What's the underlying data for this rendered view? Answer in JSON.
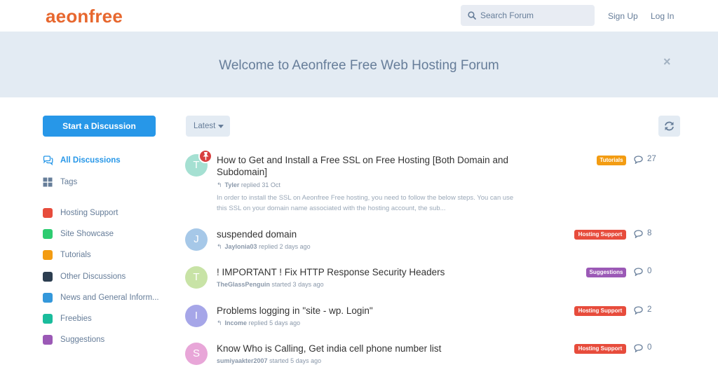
{
  "header": {
    "logo": "aeonfree",
    "search_placeholder": "Search Forum",
    "sign_up": "Sign Up",
    "log_in": "Log In"
  },
  "hero": {
    "text": "Welcome to Aeonfree Free Web Hosting Forum",
    "close": "×"
  },
  "sidebar": {
    "start_button": "Start a Discussion",
    "nav": [
      {
        "label": "All Discussions",
        "icon": "chat-bubbles-icon",
        "active": true
      },
      {
        "label": "Tags",
        "icon": "grid-icon",
        "active": false
      }
    ],
    "tags": [
      {
        "label": "Hosting Support",
        "color": "#e74c3c"
      },
      {
        "label": "Site Showcase",
        "color": "#2ecc71"
      },
      {
        "label": "Tutorials",
        "color": "#f39c12"
      },
      {
        "label": "Other Discussions",
        "color": "#2c3e50"
      },
      {
        "label": "News and General Inform...",
        "color": "#3498db"
      },
      {
        "label": "Freebies",
        "color": "#1abc9c"
      },
      {
        "label": "Suggestions",
        "color": "#9b59b6"
      }
    ]
  },
  "toolbar": {
    "sort_label": "Latest"
  },
  "discussions": [
    {
      "avatar": "T",
      "avatar_color": "#a5e0d2",
      "pinned": true,
      "title": "How to Get and Install a Free SSL on Free Hosting [Both Domain and Subdomain]",
      "user": "Tyler",
      "action": "replied 31 Oct",
      "has_reply_icon": true,
      "excerpt": "In order to install the SSL on Aeonfree Free hosting, you need to follow the below steps. You can use this SSL on your domain name associated with the hosting account, the sub...",
      "tag": "Tutorials",
      "tag_color": "#f39c12",
      "replies": "27"
    },
    {
      "avatar": "J",
      "avatar_color": "#a6c8e8",
      "pinned": false,
      "title": "suspended domain",
      "user": "Jaylonia03",
      "action": "replied 2 days ago",
      "has_reply_icon": true,
      "excerpt": "",
      "tag": "Hosting Support",
      "tag_color": "#e74c3c",
      "replies": "8"
    },
    {
      "avatar": "T",
      "avatar_color": "#c8e3a6",
      "pinned": false,
      "title": "! IMPORTANT ! Fix HTTP Response Security Headers",
      "user": "TheGlassPenguin",
      "action": "started 3 days ago",
      "has_reply_icon": false,
      "excerpt": "",
      "tag": "Suggestions",
      "tag_color": "#9b59b6",
      "replies": "0"
    },
    {
      "avatar": "I",
      "avatar_color": "#a6a6e8",
      "pinned": false,
      "title": "Problems logging in \"site - wp. Login\"",
      "user": "Income",
      "action": "replied 5 days ago",
      "has_reply_icon": true,
      "excerpt": "",
      "tag": "Hosting Support",
      "tag_color": "#e74c3c",
      "replies": "2"
    },
    {
      "avatar": "S",
      "avatar_color": "#e8a6d8",
      "pinned": false,
      "title": "Know Who is Calling, Get india cell phone number list",
      "user": "sumiyaakter2007",
      "action": "started 5 days ago",
      "has_reply_icon": false,
      "excerpt": "",
      "tag": "Hosting Support",
      "tag_color": "#e74c3c",
      "replies": "0"
    }
  ]
}
